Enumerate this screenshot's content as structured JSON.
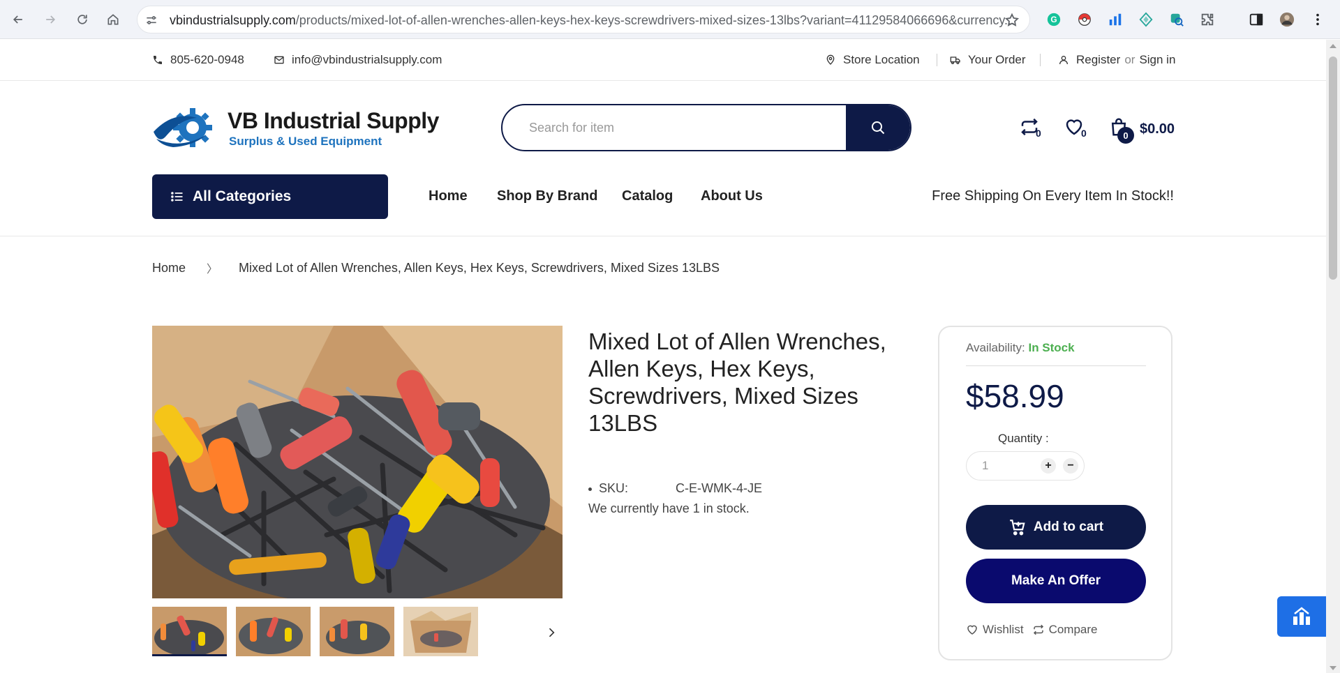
{
  "browser": {
    "url_domain": "vbindustrialsupply.com",
    "url_path": "/products/mixed-lot-of-allen-wrenches-allen-keys-hex-keys-screwdrivers-mixed-sizes-13lbs?variant=41129584066696&currency..."
  },
  "topbar": {
    "phone": "805-620-0948",
    "email": "info@vbindustrialsupply.com",
    "store_location": "Store Location",
    "your_order": "Your Order",
    "register": "Register",
    "or": "or",
    "sign_in": "Sign in"
  },
  "header": {
    "logo_name": "VB Industrial Supply",
    "logo_tagline": "Surplus & Used Equipment",
    "search_placeholder": "Search for item",
    "compare_count": "0",
    "wishlist_count": "0",
    "cart_count": "0",
    "cart_total": "$0.00"
  },
  "nav": {
    "all_categories": "All Categories",
    "items": [
      "Home",
      "Shop By Brand",
      "Catalog",
      "About Us"
    ],
    "promo": "Free Shipping On Every Item In Stock!!"
  },
  "breadcrumb": {
    "home": "Home",
    "separator": "〉",
    "current": "Mixed Lot of Allen Wrenches, Allen Keys, Hex Keys, Screwdrivers, Mixed Sizes 13LBS"
  },
  "product": {
    "title": "Mixed Lot of Allen Wrenches, Allen Keys, Hex Keys, Screwdrivers, Mixed Sizes 13LBS",
    "sku_label": "SKU:",
    "sku_value": "C-E-WMK-4-JE",
    "stock_message": "We currently have 1 in stock.",
    "thumbnail_count": 4
  },
  "buybox": {
    "availability_label": "Availability:",
    "availability_value": "In Stock",
    "price": "$58.99",
    "quantity_label": "Quantity :",
    "quantity_value": "1",
    "plus": "+",
    "minus": "−",
    "add_to_cart": "Add to cart",
    "make_offer": "Make An Offer",
    "wishlist": "Wishlist",
    "compare": "Compare"
  },
  "colors": {
    "navy": "#0e1a47",
    "offer_button": "#0a0a6e",
    "in_stock": "#4caf50",
    "logo_blue": "#1e73be",
    "float_button": "#1e6fe6"
  }
}
